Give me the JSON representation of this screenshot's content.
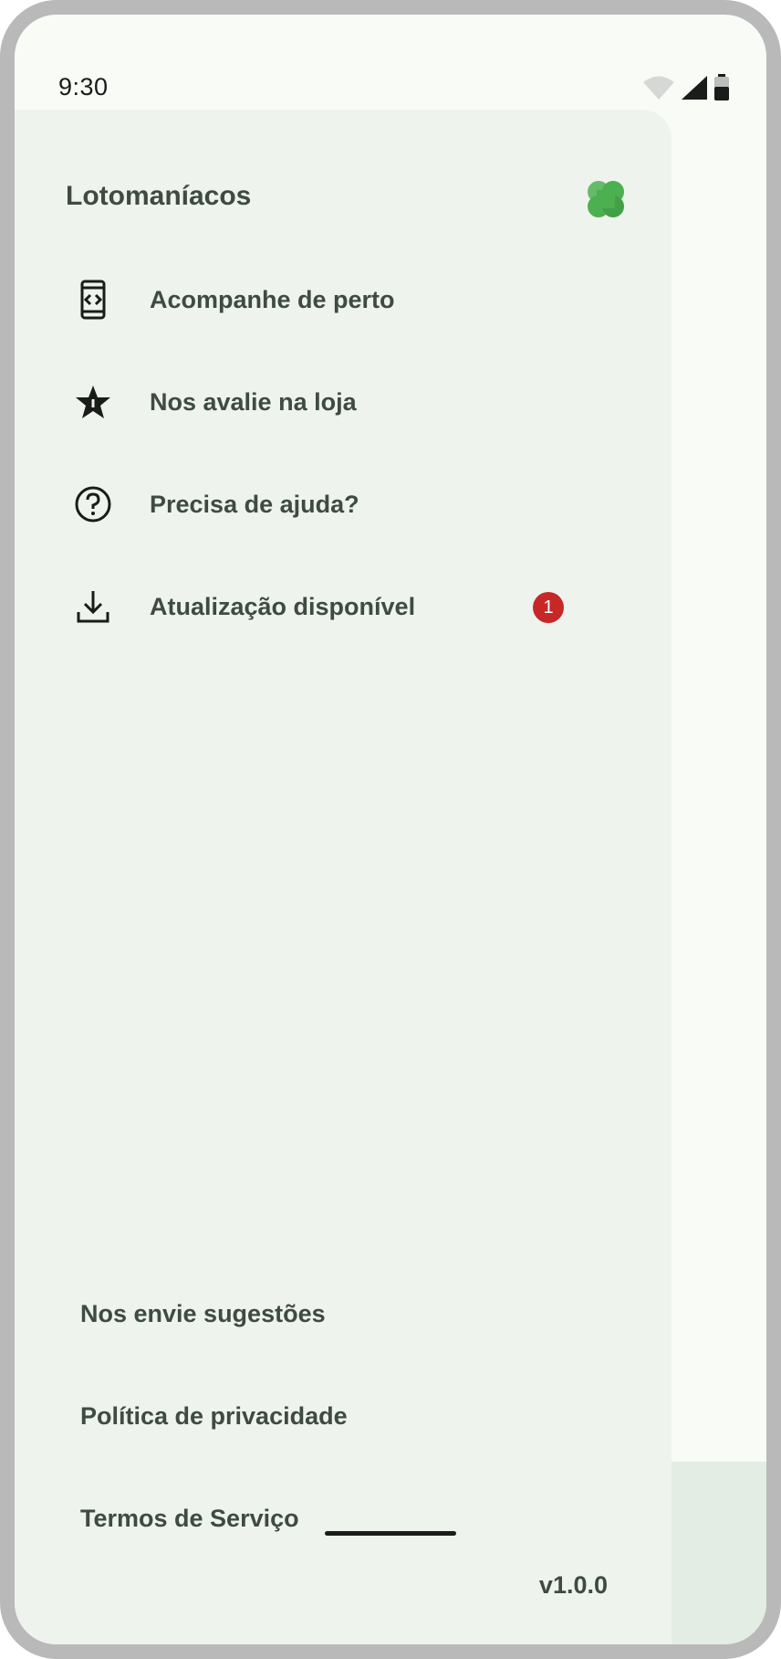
{
  "status_bar": {
    "time": "9:30"
  },
  "drawer": {
    "title": "Lotomaníacos",
    "menu_items": [
      {
        "label": "Acompanhe de perto",
        "icon": "phone-code-icon"
      },
      {
        "label": "Nos avalie na loja",
        "icon": "star-icon"
      },
      {
        "label": "Precisa de ajuda?",
        "icon": "help-circle-icon"
      },
      {
        "label": "Atualização disponível",
        "icon": "download-icon",
        "badge": "1"
      }
    ],
    "footer_links": [
      {
        "label": "Nos envie sugestões"
      },
      {
        "label": "Política de privacidade"
      },
      {
        "label": "Termos de Serviço"
      }
    ],
    "version": "v1.0.0"
  },
  "colors": {
    "drawer_bg": "#eef4ed",
    "screen_bg": "#f9fbf7",
    "text": "#3f4a42",
    "badge": "#c62828",
    "logo_green": "#4caf50"
  }
}
